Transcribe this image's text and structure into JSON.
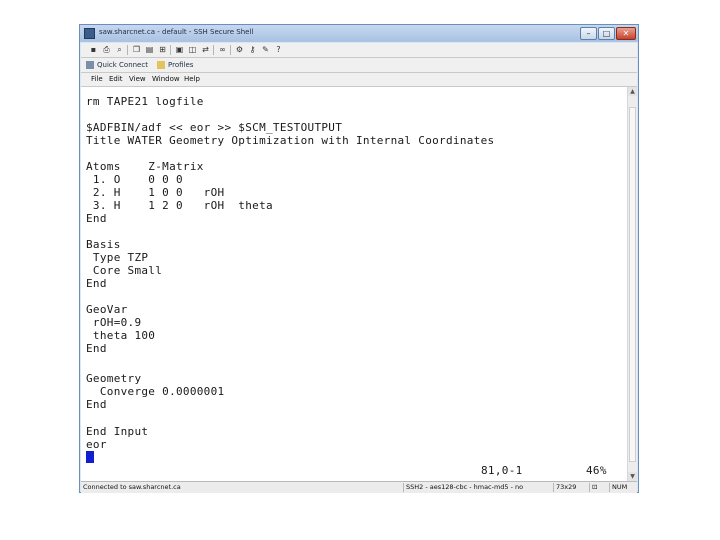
{
  "window": {
    "title": "saw.sharcnet.ca - default - SSH Secure Shell",
    "buttons": {
      "minimize": "–",
      "maximize": "□",
      "close": "✕"
    }
  },
  "toolbar": {
    "icons": [
      "save-icon",
      "print-icon",
      "search-icon",
      "copy-icon",
      "paste-icon",
      "find-icon",
      "clipboard-icon",
      "new-window-icon",
      "transfer-icon",
      "settings-icon",
      "binoculars-icon",
      "key-icon",
      "profile-icon",
      "resize-icon",
      "help-icon"
    ]
  },
  "quick_connect": {
    "label": "Quick Connect",
    "profiles_label": "Profiles"
  },
  "menu": [
    "File",
    "Edit",
    "View",
    "Window",
    "Help"
  ],
  "terminal": {
    "lines": [
      "rm TAPE21 logfile",
      "",
      "$ADFBIN/adf << eor >> $SCM_TESTOUTPUT",
      "Title WATER Geometry Optimization with Internal Coordinates",
      "",
      "Atoms    Z-Matrix",
      " 1. O    0 0 0",
      " 2. H    1 0 0   rOH",
      " 3. H    1 2 0   rOH  theta",
      "End",
      "",
      "Basis",
      " Type TZP",
      " Core Small",
      "End",
      "",
      "GeoVar",
      " rOH=0.9",
      " theta 100",
      "End",
      "",
      "Geometry",
      "  Converge 0.0000001",
      "End",
      "",
      "End Input",
      "eor"
    ],
    "position_line": "81,0-1",
    "position_percent": "46%"
  },
  "status": {
    "connection": "Connected to saw.sharcnet.ca",
    "protocol": "SSH2 - aes128-cbc - hmac-md5 - no",
    "size": "73x29",
    "num": "NUM"
  }
}
